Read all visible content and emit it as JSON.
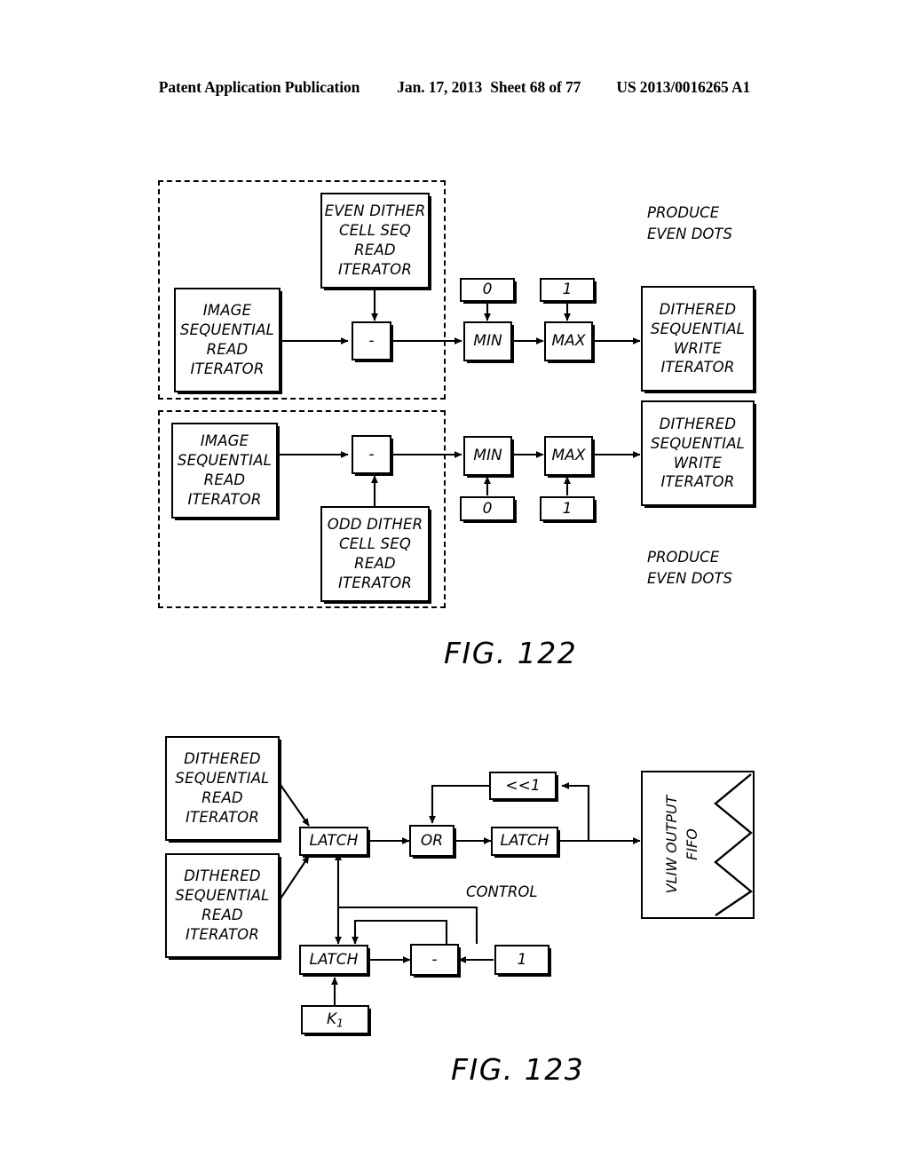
{
  "header": {
    "publication": "Patent Application Publication",
    "date": "Jan. 17, 2013",
    "sheet": "Sheet 68 of 77",
    "number": "US 2013/0016265 A1"
  },
  "figures": [
    {
      "id": "fig122",
      "caption": "FIG. 122",
      "annotations": [
        {
          "name": "produce-even-dots-top",
          "lines": [
            "PRODUCE",
            "EVEN DOTS"
          ]
        },
        {
          "name": "produce-even-dots-bottom",
          "lines": [
            "PRODUCE",
            "EVEN DOTS"
          ]
        }
      ],
      "groups": [
        {
          "name": "even-dither-group",
          "label": ""
        },
        {
          "name": "odd-dither-group",
          "label": ""
        }
      ],
      "blocks": [
        {
          "name": "even-dither-cell-seq-read-iterator",
          "lines": [
            "EVEN DITHER",
            "CELL SEQ",
            "READ",
            "ITERATOR"
          ]
        },
        {
          "name": "image-sequential-read-iterator-even",
          "lines": [
            "IMAGE",
            "SEQUENTIAL",
            "READ",
            "ITERATOR"
          ]
        },
        {
          "name": "subtract-even",
          "lines": [
            "-"
          ]
        },
        {
          "name": "const-zero-even",
          "lines": [
            "0"
          ]
        },
        {
          "name": "const-one-even",
          "lines": [
            "1"
          ]
        },
        {
          "name": "min-even",
          "lines": [
            "MIN"
          ]
        },
        {
          "name": "max-even",
          "lines": [
            "MAX"
          ]
        },
        {
          "name": "dithered-sequential-write-iterator-even",
          "lines": [
            "DITHERED",
            "SEQUENTIAL",
            "WRITE",
            "ITERATOR"
          ]
        },
        {
          "name": "image-sequential-read-iterator-odd",
          "lines": [
            "IMAGE",
            "SEQUENTIAL",
            "READ",
            "ITERATOR"
          ]
        },
        {
          "name": "subtract-odd",
          "lines": [
            "-"
          ]
        },
        {
          "name": "odd-dither-cell-seq-read-iterator",
          "lines": [
            "ODD DITHER",
            "CELL SEQ",
            "READ",
            "ITERATOR"
          ]
        },
        {
          "name": "min-odd",
          "lines": [
            "MIN"
          ]
        },
        {
          "name": "max-odd",
          "lines": [
            "MAX"
          ]
        },
        {
          "name": "const-zero-odd",
          "lines": [
            "0"
          ]
        },
        {
          "name": "const-one-odd",
          "lines": [
            "1"
          ]
        },
        {
          "name": "dithered-sequential-write-iterator-odd",
          "lines": [
            "DITHERED",
            "SEQUENTIAL",
            "WRITE",
            "ITERATOR"
          ]
        }
      ]
    },
    {
      "id": "fig123",
      "caption": "FIG. 123",
      "annotations": [
        {
          "name": "control-label",
          "lines": [
            "CONTROL"
          ]
        }
      ],
      "blocks": [
        {
          "name": "dithered-sequential-read-iterator-1",
          "lines": [
            "DITHERED",
            "SEQUENTIAL",
            "READ",
            "ITERATOR"
          ]
        },
        {
          "name": "dithered-sequential-read-iterator-2",
          "lines": [
            "DITHERED",
            "SEQUENTIAL",
            "READ",
            "ITERATOR"
          ]
        },
        {
          "name": "latch-input",
          "lines": [
            "LATCH"
          ]
        },
        {
          "name": "or-gate",
          "lines": [
            "OR"
          ]
        },
        {
          "name": "shift-left-1",
          "lines": [
            "<<1"
          ]
        },
        {
          "name": "latch-output",
          "lines": [
            "LATCH"
          ]
        },
        {
          "name": "vliw-output-fifo",
          "lines": [
            "VLIW OUTPUT",
            "FIFO"
          ]
        },
        {
          "name": "latch-counter",
          "lines": [
            "LATCH"
          ]
        },
        {
          "name": "subtract-counter",
          "lines": [
            "-"
          ]
        },
        {
          "name": "const-one-counter",
          "lines": [
            "1"
          ]
        },
        {
          "name": "constant-k1",
          "lines": [
            "K",
            "1"
          ]
        }
      ]
    }
  ]
}
